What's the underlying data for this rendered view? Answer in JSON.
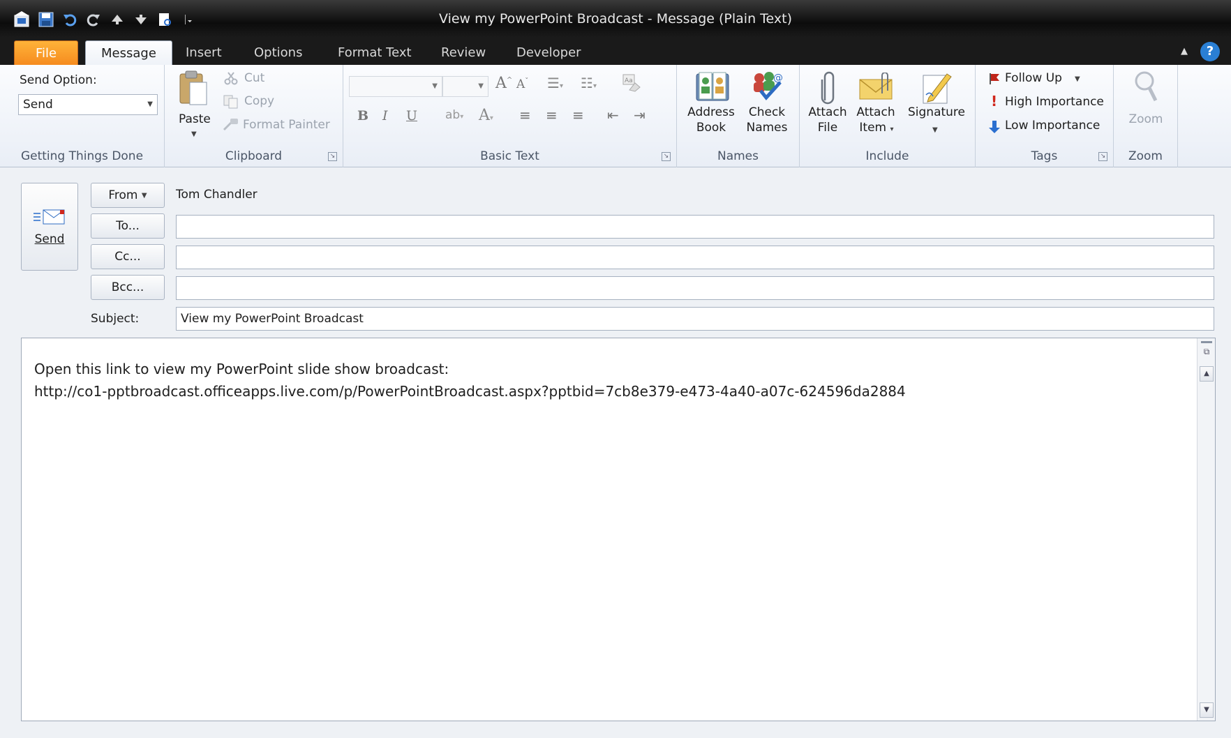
{
  "window": {
    "title": "View my PowerPoint Broadcast  -  Message (Plain Text)"
  },
  "tabs": [
    {
      "label": "File"
    },
    {
      "label": "Message"
    },
    {
      "label": "Insert"
    },
    {
      "label": "Options"
    },
    {
      "label": "Format Text"
    },
    {
      "label": "Review"
    },
    {
      "label": "Developer"
    }
  ],
  "ribbon": {
    "send_option": {
      "label": "Send Option:",
      "value": "Send",
      "group": "Getting Things Done"
    },
    "clipboard": {
      "paste": "Paste",
      "cut": "Cut",
      "copy": "Copy",
      "format_painter": "Format Painter",
      "group": "Clipboard"
    },
    "basic_text": {
      "group": "Basic Text",
      "bold": "B",
      "italic": "I",
      "underline": "U",
      "font_color": "A",
      "grow": "A",
      "shrink": "A"
    },
    "names": {
      "address_book_1": "Address",
      "address_book_2": "Book",
      "check_names_1": "Check",
      "check_names_2": "Names",
      "group": "Names"
    },
    "include": {
      "attach_file_1": "Attach",
      "attach_file_2": "File",
      "attach_item_1": "Attach",
      "attach_item_2": "Item",
      "signature": "Signature",
      "group": "Include"
    },
    "tags": {
      "follow_up": "Follow Up",
      "high": "High Importance",
      "low": "Low Importance",
      "group": "Tags"
    },
    "zoom": {
      "label": "Zoom",
      "group": "Zoom"
    }
  },
  "compose": {
    "send_label": "Send",
    "from_label": "From",
    "from_value": "Tom Chandler",
    "to_label": "To...",
    "cc_label": "Cc...",
    "bcc_label": "Bcc...",
    "subject_label": "Subject:",
    "to_value": "",
    "cc_value": "",
    "bcc_value": "",
    "subject_value": "View my PowerPoint Broadcast",
    "body_line1": "Open this link to view my PowerPoint slide show broadcast:",
    "body_line2": "http://co1-pptbroadcast.officeapps.live.com/p/PowerPointBroadcast.aspx?pptbid=7cb8e379-e473-4a40-a07c-624596da2884"
  },
  "colors": {
    "file_tab": "#f58a1e",
    "title_bar": "#0c0c0c",
    "ribbon": "#e9eef6",
    "help": "#2a7fd4"
  }
}
